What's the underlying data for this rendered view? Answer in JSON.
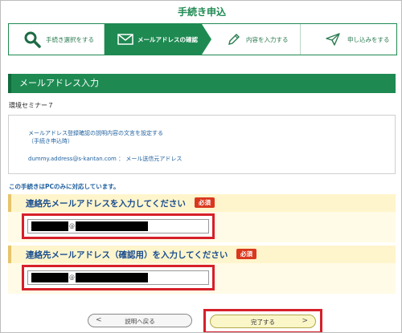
{
  "header": {
    "title": "手続き申込"
  },
  "steps": [
    {
      "label": "手続き選択をする",
      "icon": "search-icon"
    },
    {
      "label": "メールアドレスの確認",
      "icon": "envelope-icon",
      "active": true
    },
    {
      "label": "内容を入力する",
      "icon": "pencil-icon"
    },
    {
      "label": "申し込みをする",
      "icon": "send-icon"
    }
  ],
  "section": {
    "title": "メールアドレス入力"
  },
  "seminar": {
    "name": "環境セミナー７"
  },
  "info": {
    "line1": "メールアドレス登録確認の説明内容の文言を設定する",
    "line2": "（手続き申込時）",
    "line3": "dummy.address@s-kantan.com ： メール送信元アドレス"
  },
  "notice": {
    "pc_only": "この手続きはPCのみに対応しています。"
  },
  "email_field": {
    "label": "連絡先メールアドレスを入力してください",
    "required": "必須",
    "at": "@"
  },
  "email_confirm_field": {
    "label": "連絡先メールアドレス（確認用）を入力してください",
    "required": "必須",
    "at": "@"
  },
  "buttons": {
    "back": "説明へ戻る",
    "next": "完了する"
  },
  "colors": {
    "brand_green": "#1e8a52",
    "highlight_red": "#d6202a",
    "required_red": "#d9381e"
  }
}
